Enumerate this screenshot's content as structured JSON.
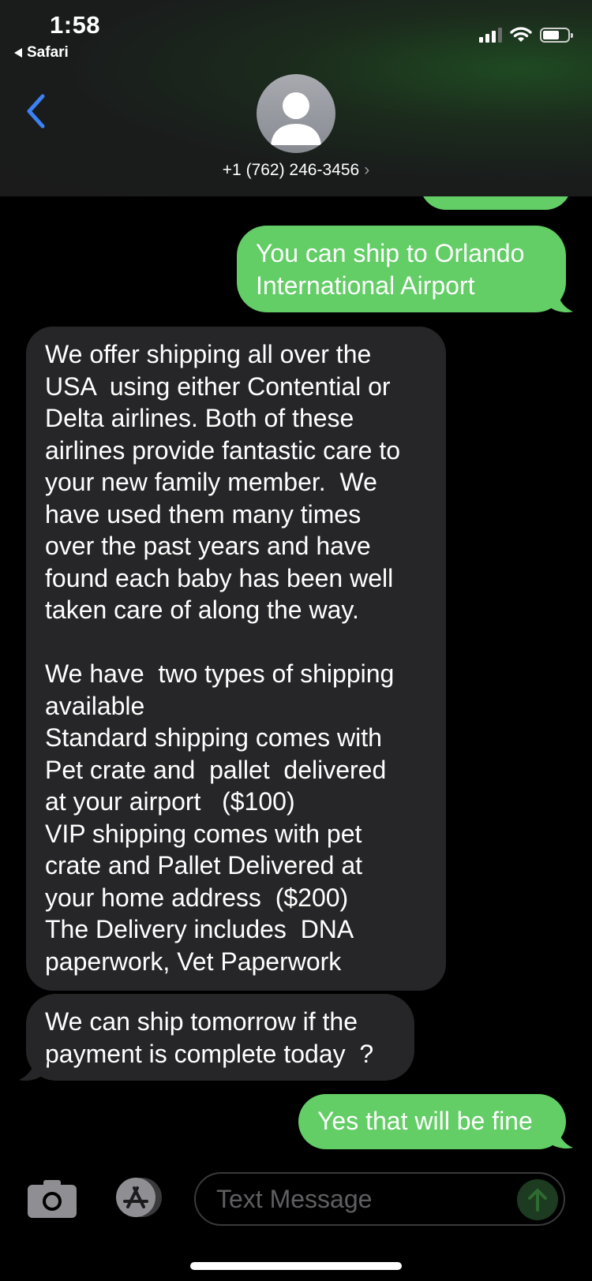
{
  "status_bar": {
    "time": "1:58",
    "back_app": "Safari"
  },
  "conversation": {
    "contact_name": "+1 (762) 246-3456",
    "contact_chevron": "›"
  },
  "messages": [
    {
      "direction": "sent",
      "text": "You can ship to Orlando\nInternational Airport"
    },
    {
      "direction": "received",
      "text": "We offer shipping all over the\nUSA  using either Contential or\nDelta airlines. Both of these\nairlines provide fantastic care to\nyour new family member.  We\nhave used them many times\nover the past years and have\nfound each baby has been well\ntaken care of along the way.\n\nWe have  two types of shipping\navailable\nStandard shipping comes with\nPet crate and  pallet  delivered\nat your airport   ($100)\nVIP shipping comes with pet\ncrate and Pallet Delivered at\nyour home address  ($200)\nThe Delivery includes  DNA\npaperwork, Vet Paperwork"
    },
    {
      "direction": "received",
      "text": "We can ship tomorrow if the\npayment is complete today  ?"
    },
    {
      "direction": "sent",
      "text": "Yes that will be fine"
    }
  ],
  "composer": {
    "placeholder": "Text Message"
  },
  "icons": {
    "back": "chevron-left-icon",
    "avatar": "person-icon",
    "camera": "camera-icon",
    "apps": "app-store-icon",
    "send": "arrow-up-icon",
    "signal": "cellular-signal-icon",
    "wifi": "wifi-icon",
    "battery": "battery-icon"
  },
  "colors": {
    "sent_bubble": "#63cd66",
    "received_bubble": "#262628",
    "accent_blue": "#3b82f6"
  }
}
